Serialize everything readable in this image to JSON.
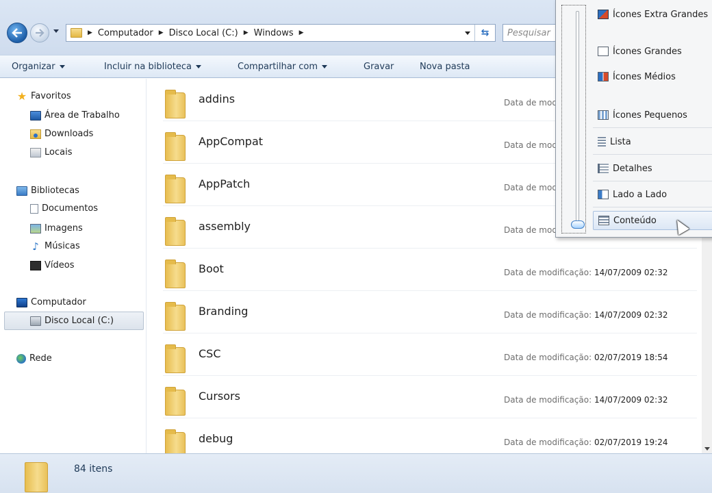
{
  "address_bar": {
    "crumbs": [
      "Computador",
      "Disco Local (C:)",
      "Windows"
    ],
    "search_placeholder": "Pesquisar"
  },
  "toolbar": {
    "organize": "Organizar",
    "include_library": "Incluir na biblioteca",
    "share_with": "Compartilhar com",
    "burn": "Gravar",
    "new_folder": "Nova pasta"
  },
  "sidebar": {
    "favorites": "Favoritos",
    "desktop": "Área de Trabalho",
    "downloads": "Downloads",
    "places": "Locais",
    "libraries": "Bibliotecas",
    "documents": "Documentos",
    "images": "Imagens",
    "music": "Músicas",
    "videos": "Vídeos",
    "computer": "Computador",
    "local_disk": "Disco Local (C:)",
    "network": "Rede"
  },
  "files": {
    "modified_label": "Data de modificação:",
    "rows": [
      {
        "name": "addins",
        "date": ""
      },
      {
        "name": "AppCompat",
        "date": ""
      },
      {
        "name": "AppPatch",
        "date": ""
      },
      {
        "name": "assembly",
        "date": ""
      },
      {
        "name": "Boot",
        "date": "14/07/2009 02:32"
      },
      {
        "name": "Branding",
        "date": "14/07/2009 02:32"
      },
      {
        "name": "CSC",
        "date": "02/07/2019 18:54"
      },
      {
        "name": "Cursors",
        "date": "14/07/2009 02:32"
      },
      {
        "name": "debug",
        "date": "02/07/2019 19:24"
      }
    ]
  },
  "status": {
    "item_count": "84 itens"
  },
  "view_menu": {
    "extra_large": "Ícones Extra Grandes",
    "large": "Ícones Grandes",
    "medium": "Ícones Médios",
    "small": "Ícones Pequenos",
    "list": "Lista",
    "details": "Detalhes",
    "tiles": "Lado a Lado",
    "content": "Conteúdo",
    "selected": "Conteúdo"
  }
}
